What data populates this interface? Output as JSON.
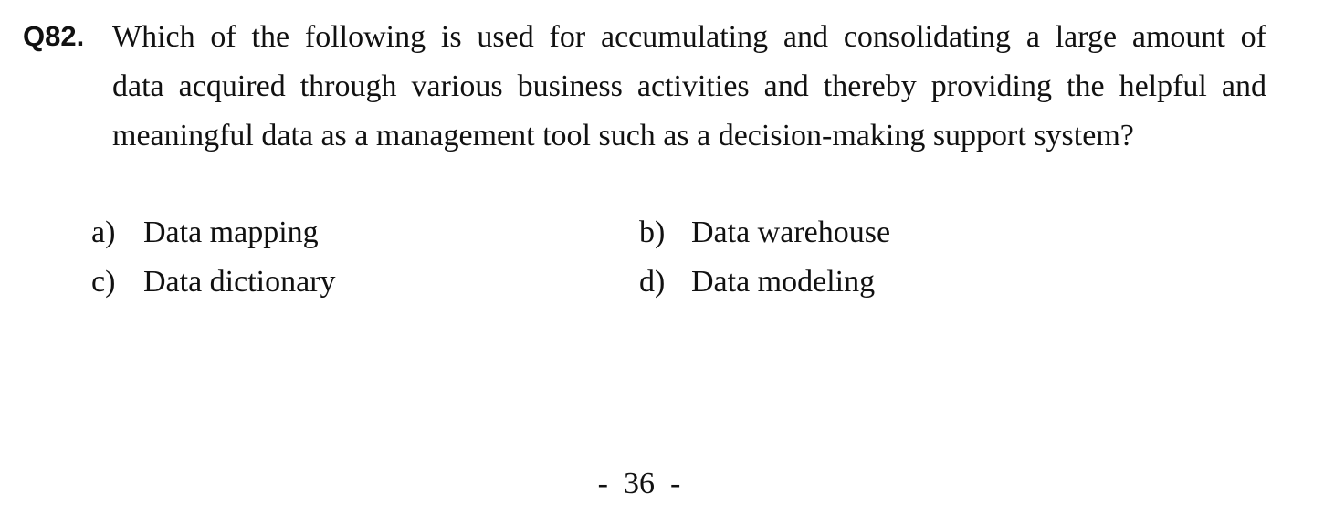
{
  "question": {
    "number": "Q82.",
    "lines": [
      "Which of the following is used for accumulating and consolidating a large amount of",
      "data acquired through various business activities and thereby providing the helpful and",
      "meaningful data as a management tool such as a decision-making support system?"
    ]
  },
  "options": [
    {
      "letter": "a)",
      "text": "Data mapping"
    },
    {
      "letter": "b)",
      "text": "Data warehouse"
    },
    {
      "letter": "c)",
      "text": "Data dictionary"
    },
    {
      "letter": "d)",
      "text": "Data modeling"
    }
  ],
  "page": {
    "number": "-  36  -"
  }
}
